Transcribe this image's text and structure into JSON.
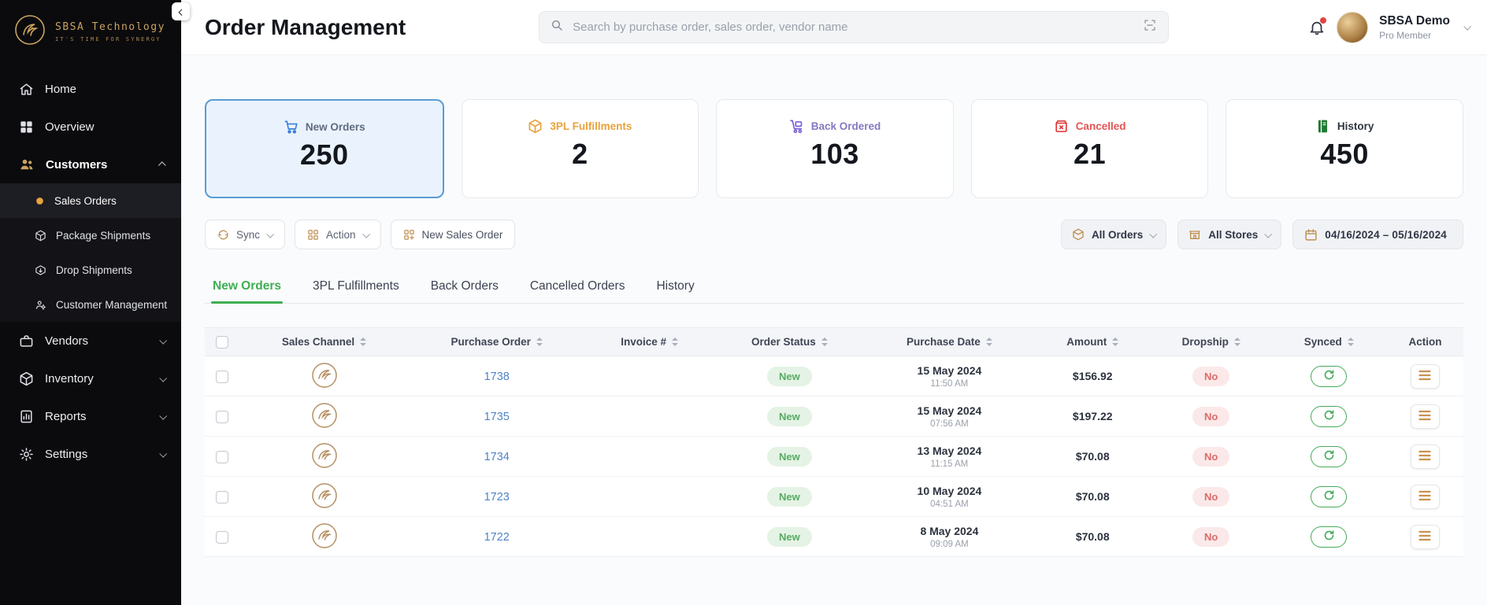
{
  "theme": {
    "accent_gold": "#bd8f52",
    "active_card_blue": "#5b9bd5",
    "tab_active_green": "#3fae52",
    "link_blue": "#4f83c6",
    "success_green": "#43ab57",
    "danger_red": "#e04545"
  },
  "sidebar": {
    "logo": {
      "name": "SBSA Technology",
      "tagline": "IT'S TIME FOR SYNERGY"
    },
    "items": [
      {
        "label": "Home"
      },
      {
        "label": "Overview"
      },
      {
        "label": "Customers",
        "expanded": true,
        "children": [
          {
            "label": "Sales Orders",
            "active": true
          },
          {
            "label": "Package Shipments"
          },
          {
            "label": "Drop Shipments"
          },
          {
            "label": "Customer Management"
          }
        ]
      },
      {
        "label": "Vendors"
      },
      {
        "label": "Inventory"
      },
      {
        "label": "Reports"
      },
      {
        "label": "Settings"
      }
    ]
  },
  "header": {
    "title": "Order Management",
    "search_placeholder": "Search by purchase order, sales order, vendor name",
    "user_name": "SBSA Demo",
    "user_plan": "Pro Member"
  },
  "stats": [
    {
      "label": "New Orders",
      "value": "250",
      "color": "#3d7fd9",
      "label_color": "#5f6b80",
      "active": true
    },
    {
      "label": "3PL Fulfillments",
      "value": "2",
      "color": "#e9a13b",
      "label_color": "#e9a13b"
    },
    {
      "label": "Back Ordered",
      "value": "103",
      "color": "#7a5fd0",
      "label_color": "#8579c1"
    },
    {
      "label": "Cancelled",
      "value": "21",
      "color": "#e23c3c",
      "label_color": "#e25555"
    },
    {
      "label": "History",
      "value": "450",
      "color": "#1f7a33",
      "label_color": "#2f3640"
    }
  ],
  "toolbar": {
    "sync_label": "Sync",
    "action_label": "Action",
    "new_sales_order_label": "New Sales Order",
    "orders_filter": "All Orders",
    "stores_filter": "All Stores",
    "date_range": "04/16/2024 – 05/16/2024"
  },
  "tabs": [
    {
      "label": "New Orders",
      "active": true
    },
    {
      "label": "3PL Fulfillments"
    },
    {
      "label": "Back Orders"
    },
    {
      "label": "Cancelled Orders"
    },
    {
      "label": "History"
    }
  ],
  "table": {
    "columns": [
      "Sales Channel",
      "Purchase Order",
      "Invoice #",
      "Order Status",
      "Purchase Date",
      "Amount",
      "Dropship",
      "Synced",
      "Action"
    ],
    "rows": [
      {
        "purchase_order": "1738",
        "invoice": "",
        "status": "New",
        "date": "15 May 2024",
        "time": "11:50 AM",
        "amount": "$156.92",
        "dropship": "No"
      },
      {
        "purchase_order": "1735",
        "invoice": "",
        "status": "New",
        "date": "15 May 2024",
        "time": "07:56 AM",
        "amount": "$197.22",
        "dropship": "No"
      },
      {
        "purchase_order": "1734",
        "invoice": "",
        "status": "New",
        "date": "13 May 2024",
        "time": "11:15 AM",
        "amount": "$70.08",
        "dropship": "No"
      },
      {
        "purchase_order": "1723",
        "invoice": "",
        "status": "New",
        "date": "10 May 2024",
        "time": "04:51 AM",
        "amount": "$70.08",
        "dropship": "No"
      },
      {
        "purchase_order": "1722",
        "invoice": "",
        "status": "New",
        "date": "8 May 2024",
        "time": "09:09 AM",
        "amount": "$70.08",
        "dropship": "No"
      }
    ]
  }
}
